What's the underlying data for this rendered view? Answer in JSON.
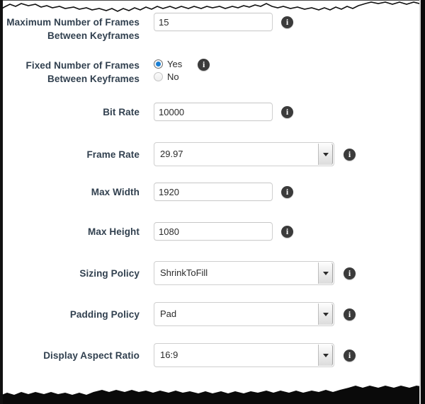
{
  "panel": {
    "info_icon_glyph": "i",
    "info_icon_name": "info-icon",
    "dropdown_icon_name": "chevron-down-icon",
    "colors": {
      "label_text": "#31404f",
      "value_text": "#2b2b2b",
      "input_border": "#cfcfcf",
      "radio_selected": "#1a7fd4",
      "info_icon_bg": "#3b3b3b",
      "torn_edge": "#0a0a0a"
    }
  },
  "fields": [
    {
      "id": "max-keyframe-frames",
      "label": "Maximum Number of Frames Between Keyframes",
      "type": "text",
      "value": "15",
      "has_info": true
    },
    {
      "id": "fixed-keyframe-frames",
      "label": "Fixed Number of Frames Between Keyframes",
      "type": "radio",
      "value": "Yes",
      "options": [
        "Yes",
        "No"
      ],
      "has_info": true
    },
    {
      "id": "bit-rate",
      "label": "Bit Rate",
      "type": "text",
      "value": "10000",
      "has_info": true
    },
    {
      "id": "frame-rate",
      "label": "Frame Rate",
      "type": "select",
      "value": "29.97",
      "has_info": true
    },
    {
      "id": "max-width",
      "label": "Max Width",
      "type": "text",
      "value": "1920",
      "has_info": true
    },
    {
      "id": "max-height",
      "label": "Max Height",
      "type": "text",
      "value": "1080",
      "has_info": true
    },
    {
      "id": "sizing-policy",
      "label": "Sizing Policy",
      "type": "select",
      "value": "ShrinkToFill",
      "has_info": true
    },
    {
      "id": "padding-policy",
      "label": "Padding Policy",
      "type": "select",
      "value": "Pad",
      "has_info": true
    },
    {
      "id": "display-aspect-ratio",
      "label": "Display Aspect Ratio",
      "type": "select",
      "value": "16:9",
      "has_info": true
    }
  ]
}
